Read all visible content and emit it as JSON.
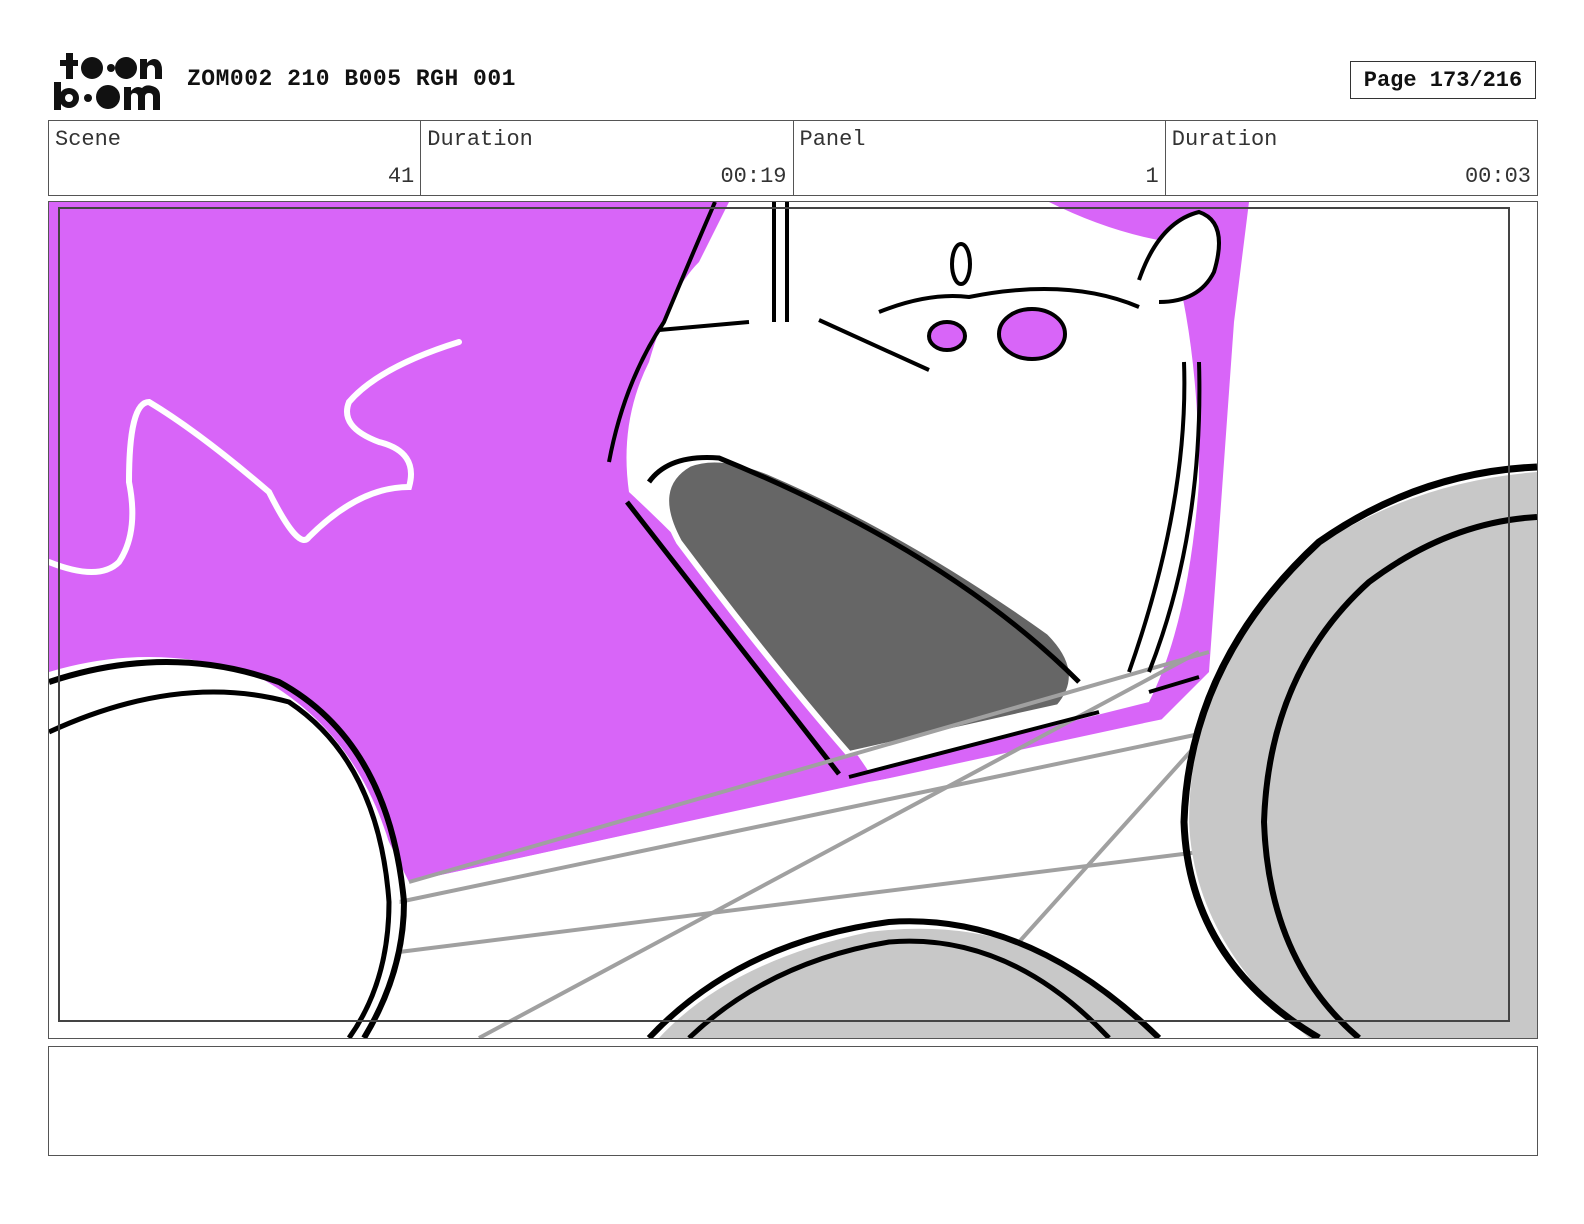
{
  "header": {
    "logo_name": "toon boom logo",
    "project_title": "ZOM002 210 B005 RGH 001",
    "page_label": "Page 173/216"
  },
  "info": {
    "scene_label": "Scene",
    "scene_value": "41",
    "scene_duration_label": "Duration",
    "scene_duration_value": "00:19",
    "panel_label": "Panel",
    "panel_value": "1",
    "panel_duration_label": "Duration",
    "panel_duration_value": "00:03"
  },
  "panel": {
    "colors": {
      "sky": "#d865f8",
      "mouth": "#666666",
      "wheel_fill": "#c8c8c8",
      "construction_line": "#a0a0a0",
      "ink": "#000000"
    }
  },
  "notes": {
    "text": ""
  }
}
